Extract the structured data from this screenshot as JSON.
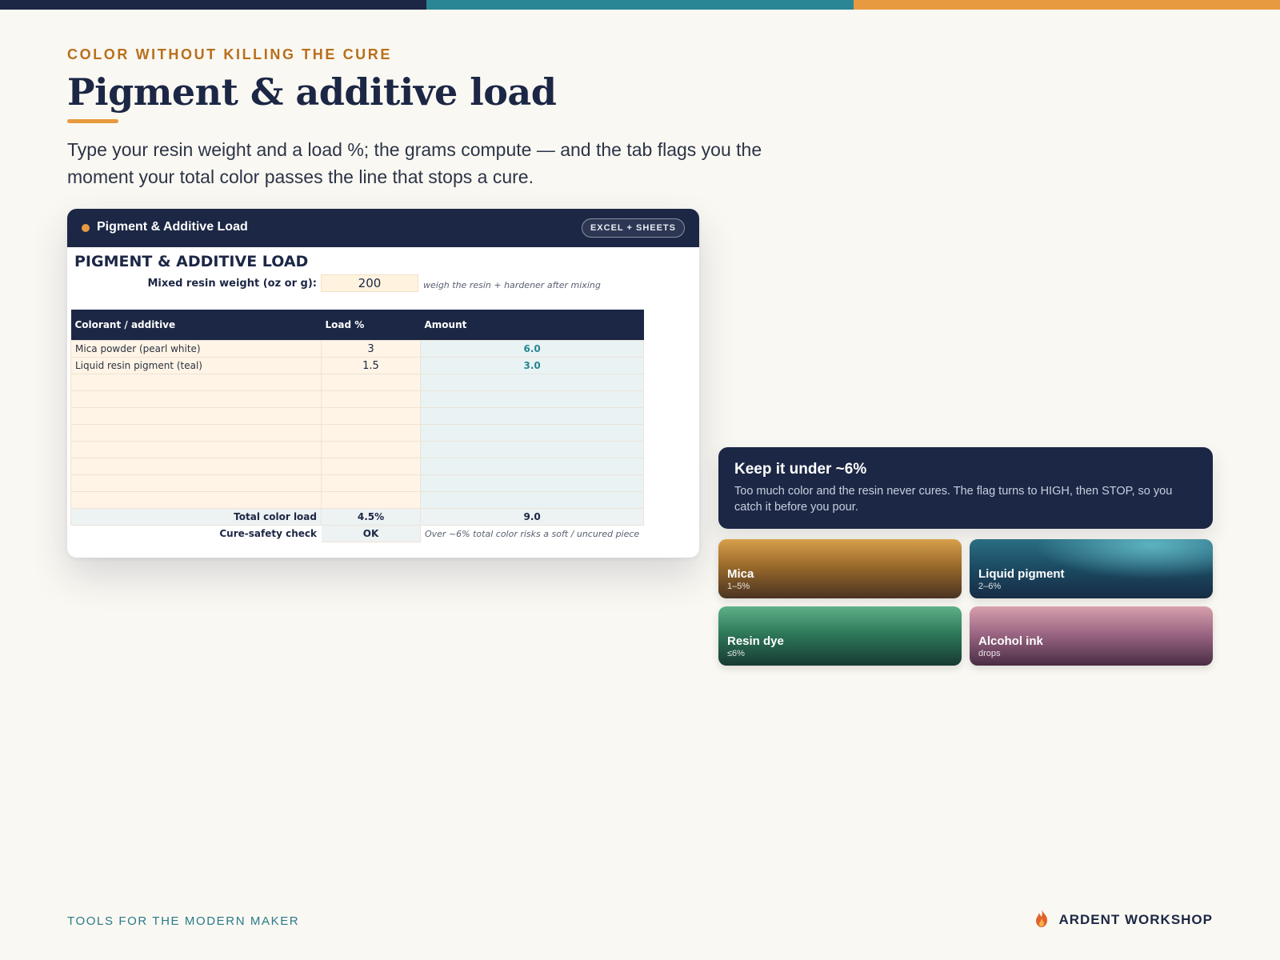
{
  "colors": {
    "navy": "#1c2745",
    "teal": "#2a8694",
    "orange": "#e89a40",
    "background": "#faf8f2"
  },
  "header": {
    "eyebrow": "COLOR WITHOUT KILLING THE CURE",
    "title": "Pigment & additive load",
    "lede": "Type your resin weight and a load %; the grams compute — and the tab flags you the moment your total color passes the line that stops a cure."
  },
  "card": {
    "window_title": "Pigment & Additive Load",
    "badge": "EXCEL + SHEETS",
    "sheet_title": "PIGMENT & ADDITIVE LOAD",
    "weight_label": "Mixed resin weight (oz or g):",
    "weight_value": "200",
    "weight_note": "weigh the resin + hardener after mixing",
    "columns": [
      "Colorant / additive",
      "Load %",
      "Amount"
    ],
    "rows": [
      {
        "name": "Mica powder (pearl white)",
        "load": "3",
        "amount": "6.0"
      },
      {
        "name": "Liquid resin pigment (teal)",
        "load": "1.5",
        "amount": "3.0"
      }
    ],
    "total_label": "Total color load",
    "total_load": "4.5%",
    "total_amount": "9.0",
    "check_label": "Cure-safety check",
    "check_value": "OK",
    "check_note": "Over ~6% total color risks a soft / uncured piece"
  },
  "callout": {
    "title": "Keep it under ~6%",
    "body": "Too much color and the resin never cures. The flag turns to HIGH, then STOP, so you catch it before you pour."
  },
  "swatches": [
    {
      "name": "Mica",
      "range": "1–5%"
    },
    {
      "name": "Liquid pigment",
      "range": "2–6%"
    },
    {
      "name": "Resin dye",
      "range": "≤6%"
    },
    {
      "name": "Alcohol ink",
      "range": "drops"
    }
  ],
  "footer": {
    "tagline": "TOOLS FOR THE MODERN MAKER",
    "brand": "ARDENT WORKSHOP"
  }
}
